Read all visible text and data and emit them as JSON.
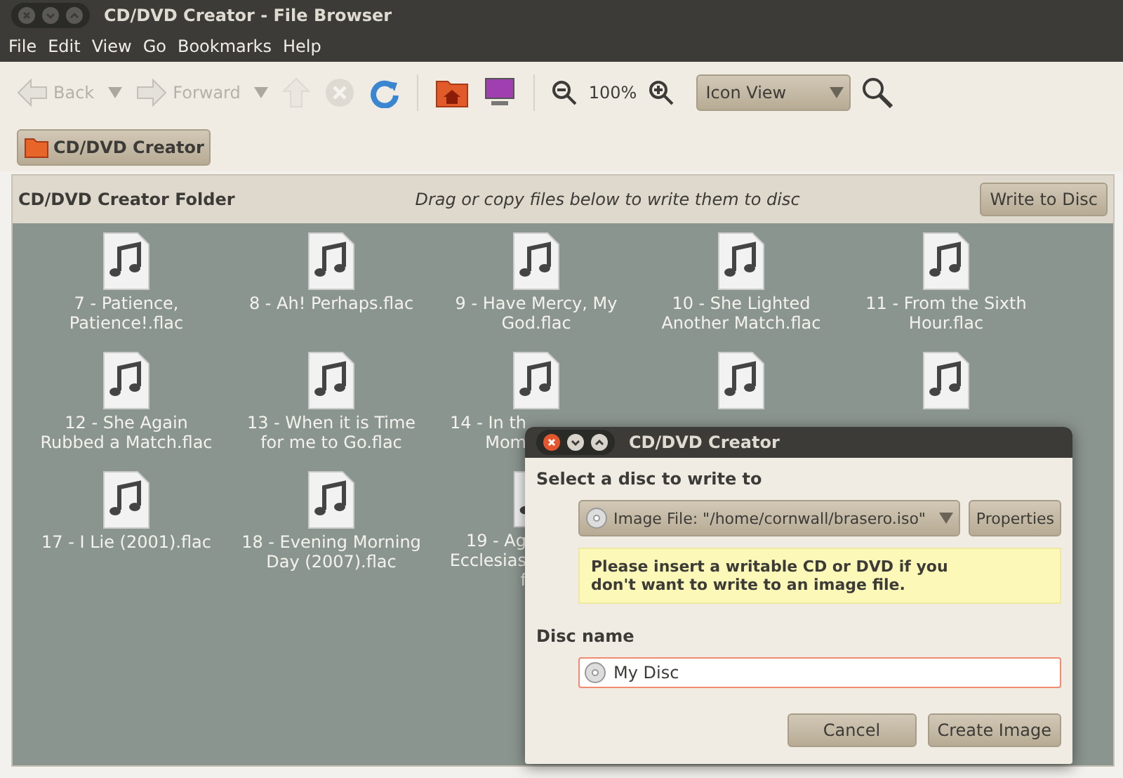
{
  "window": {
    "title": "CD/DVD Creator - File Browser"
  },
  "menu": [
    "File",
    "Edit",
    "View",
    "Go",
    "Bookmarks",
    "Help"
  ],
  "toolbar": [
    {
      "kind": "back",
      "label": "Back",
      "disabled": true
    },
    {
      "kind": "history-arrow",
      "disabled": true
    },
    {
      "kind": "forward",
      "label": "Forward",
      "disabled": true
    },
    {
      "kind": "history-arrow",
      "disabled": true
    },
    {
      "kind": "up",
      "disabled": true
    },
    {
      "kind": "stop",
      "disabled": true
    },
    {
      "kind": "reload",
      "disabled": false
    },
    {
      "kind": "separator"
    },
    {
      "kind": "home",
      "disabled": false
    },
    {
      "kind": "computer",
      "disabled": false
    },
    {
      "kind": "separator"
    },
    {
      "kind": "zoom-out",
      "disabled": false
    },
    {
      "kind": "zoom-level",
      "label": "100%"
    },
    {
      "kind": "zoom-in",
      "disabled": false
    },
    {
      "kind": "view-select",
      "label": "Icon View"
    },
    {
      "kind": "search",
      "disabled": false
    }
  ],
  "location": {
    "button": "CD/DVD Creator"
  },
  "burn_bar": {
    "title": "CD/DVD Creator Folder",
    "hint": "Drag or copy files below to write them to disc",
    "button": "Write to Disc"
  },
  "files": [
    {
      "kind": "full",
      "label": "7 - Patience, Patience!.flac"
    },
    {
      "kind": "full",
      "label": "8 - Ah! Perhaps.flac"
    },
    {
      "kind": "full",
      "label": "9 - Have Mercy, My God.flac"
    },
    {
      "kind": "full",
      "label": "10 - She Lighted Another Match.flac"
    },
    {
      "kind": "full",
      "label": "11 - From the Sixth Hour.flac"
    },
    {
      "kind": "full",
      "label": "12 - She Again Rubbed a Match.flac"
    },
    {
      "kind": "full",
      "label": "13 - When it is Time for me to Go.flac"
    },
    {
      "kind": "partial",
      "label": "14 - In th Mom"
    },
    {
      "kind": "hidden"
    },
    {
      "kind": "hidden"
    },
    {
      "kind": "full",
      "label": "17 - I Lie (2001).flac"
    },
    {
      "kind": "full",
      "label": "18 - Evening Morning Day (2007).flac"
    },
    {
      "kind": "partial",
      "label": "19 - Ag Ecclesias f"
    }
  ],
  "dialog": {
    "title": "CD/DVD Creator",
    "section": "Select a disc to write to",
    "disc": "Image File: \"/home/cornwall/brasero.iso\"",
    "properties": "Properties",
    "warning": "Please insert a writable CD or DVD if you don't want to write to an image file.",
    "name_label": "Disc name",
    "name_value": "My Disc",
    "buttons": [
      {
        "label": "Cancel"
      },
      {
        "label": "Create Image"
      }
    ]
  }
}
